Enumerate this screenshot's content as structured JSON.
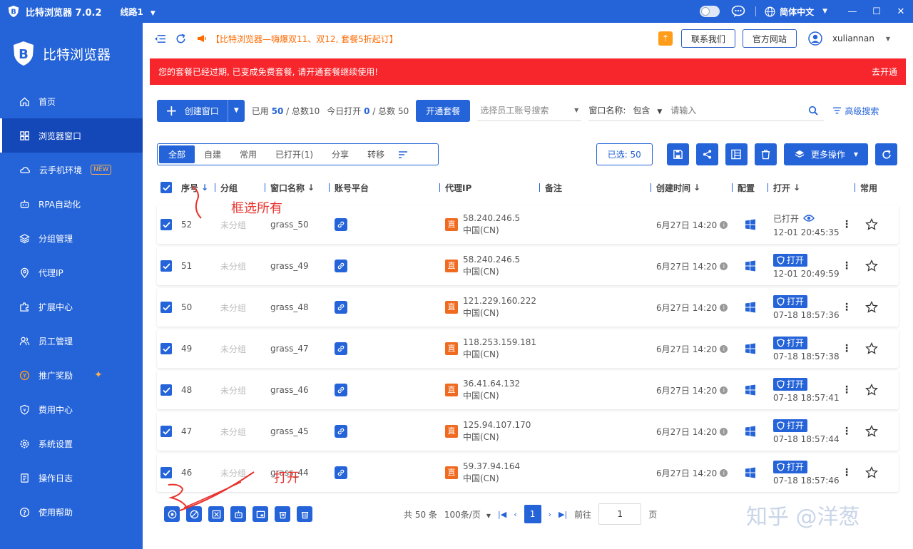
{
  "titlebar": {
    "app_title": "比特浏览器 7.0.2",
    "line": "线路1",
    "lang": "简体中文",
    "min": "—",
    "max": "☐",
    "close": "✕"
  },
  "sidebar": {
    "brand": "比特浏览器",
    "items": [
      {
        "label": "首页"
      },
      {
        "label": "浏览器窗口"
      },
      {
        "label": "云手机环境",
        "badge": "NEW"
      },
      {
        "label": "RPA自动化"
      },
      {
        "label": "分组管理"
      },
      {
        "label": "代理IP"
      },
      {
        "label": "扩展中心"
      },
      {
        "label": "员工管理"
      },
      {
        "label": "推广奖励"
      },
      {
        "label": "费用中心"
      },
      {
        "label": "系统设置"
      },
      {
        "label": "操作日志"
      },
      {
        "label": "使用帮助"
      }
    ]
  },
  "topbar": {
    "marquee": "【比特浏览器—嗨爆双11、双12, 套餐5折起订】",
    "contact": "联系我们",
    "website": "官方网站",
    "username": "xuliannan"
  },
  "banner": {
    "message": "您的套餐已经过期, 已变成免费套餐, 请开通套餐继续使用!",
    "action": "去开通"
  },
  "toolbar": {
    "create_label": "创建窗口",
    "used_prefix": "已用",
    "used": "50",
    "total_prefix": "/ 总数",
    "total": "10",
    "today_prefix": "今日打开",
    "today": "0",
    "today_total_prefix": "/ 总数",
    "today_total": "50",
    "open_plan": "开通套餐",
    "employee_placeholder": "选择员工账号搜索",
    "window_name_label": "窗口名称:",
    "match_mode": "包含",
    "search_placeholder": "请输入",
    "advanced": "高级搜索"
  },
  "tabs": [
    "全部",
    "自建",
    "常用",
    "已打开(1)",
    "分享",
    "转移"
  ],
  "actions": {
    "selected": "已选: 50",
    "more": "更多操作"
  },
  "columns": {
    "seq": "序号",
    "group": "分组",
    "name": "窗口名称",
    "platform": "账号平台",
    "proxy": "代理IP",
    "note": "备注",
    "created": "创建时间",
    "config": "配置",
    "open": "打开",
    "fav": "常用"
  },
  "rows": [
    {
      "seq": "52",
      "group": "未分组",
      "name": "grass_50",
      "ip": "58.240.246.5",
      "country": "中国(CN)",
      "created": "6月27日 14:20",
      "opened": true,
      "status": "已打开",
      "time": "12-01 20:45:35"
    },
    {
      "seq": "51",
      "group": "未分组",
      "name": "grass_49",
      "ip": "58.240.246.5",
      "country": "中国(CN)",
      "created": "6月27日 14:20",
      "opened": false,
      "status": "打开",
      "time": "12-01 20:49:59"
    },
    {
      "seq": "50",
      "group": "未分组",
      "name": "grass_48",
      "ip": "121.229.160.222",
      "country": "中国(CN)",
      "created": "6月27日 14:20",
      "opened": false,
      "status": "打开",
      "time": "07-18 18:57:36"
    },
    {
      "seq": "49",
      "group": "未分组",
      "name": "grass_47",
      "ip": "118.253.159.181",
      "country": "中国(CN)",
      "created": "6月27日 14:20",
      "opened": false,
      "status": "打开",
      "time": "07-18 18:57:38"
    },
    {
      "seq": "48",
      "group": "未分组",
      "name": "grass_46",
      "ip": "36.41.64.132",
      "country": "中国(CN)",
      "created": "6月27日 14:20",
      "opened": false,
      "status": "打开",
      "time": "07-18 18:57:41"
    },
    {
      "seq": "47",
      "group": "未分组",
      "name": "grass_45",
      "ip": "125.94.107.170",
      "country": "中国(CN)",
      "created": "6月27日 14:20",
      "opened": false,
      "status": "打开",
      "time": "07-18 18:57:44"
    },
    {
      "seq": "46",
      "group": "未分组",
      "name": "grass_44",
      "ip": "59.37.94.164",
      "country": "中国(CN)",
      "created": "6月27日 14:20",
      "opened": false,
      "status": "打开",
      "time": "07-18 18:57:46"
    }
  ],
  "pagination": {
    "total": "共 50 条",
    "per_page": "100条/页",
    "current": "1",
    "goto_label": "前往",
    "goto_value": "1",
    "page_suffix": "页"
  },
  "annotations": {
    "select_all": "框选所有",
    "open": "打开"
  },
  "watermark": "知乎 @洋葱",
  "colors": {
    "primary": "#2463d8",
    "banner": "#f7262c",
    "proxy_tag": "#f06a1f",
    "annotation": "#e8322c"
  }
}
